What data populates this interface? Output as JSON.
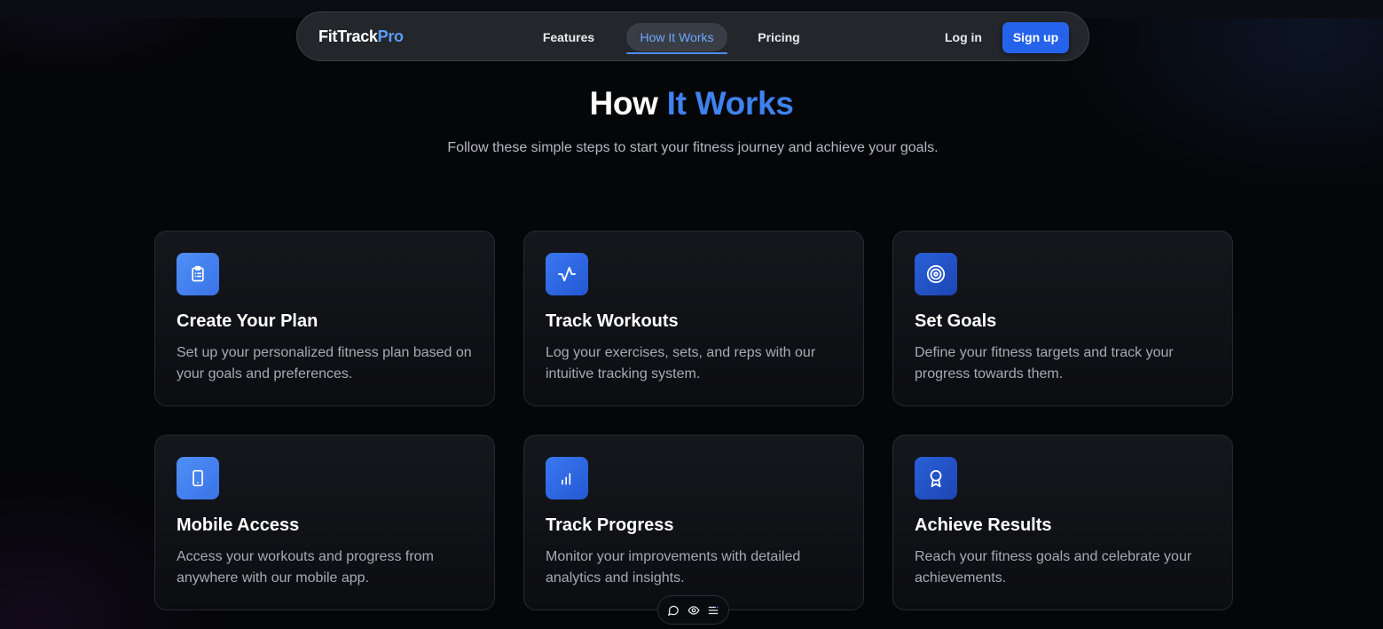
{
  "nav": {
    "logo_part1": "FitTrack",
    "logo_part2": "Pro",
    "links": [
      {
        "label": "Features"
      },
      {
        "label": "How It Works",
        "active": true
      },
      {
        "label": "Pricing"
      }
    ],
    "login_label": "Log in",
    "signup_label": "Sign up"
  },
  "hero": {
    "title_part1": "How",
    "title_part2": "It Works",
    "subtitle": "Follow these simple steps to start your fitness journey and achieve your goals."
  },
  "steps": [
    {
      "icon": "clipboard-list-icon",
      "title": "Create Your Plan",
      "description": "Set up your personalized fitness plan based on your goals and preferences."
    },
    {
      "icon": "activity-pulse-icon",
      "title": "Track Workouts",
      "description": "Log your exercises, sets, and reps with our intuitive tracking system."
    },
    {
      "icon": "target-icon",
      "title": "Set Goals",
      "description": "Define your fitness targets and track your progress towards them."
    },
    {
      "icon": "smartphone-icon",
      "title": "Mobile Access",
      "description": "Access your workouts and progress from anywhere with our mobile app."
    },
    {
      "icon": "bar-chart-icon",
      "title": "Track Progress",
      "description": "Monitor your improvements with detailed analytics and insights."
    },
    {
      "icon": "award-icon",
      "title": "Achieve Results",
      "description": "Reach your fitness goals and celebrate your achievements."
    }
  ],
  "toolbar": {
    "icons": [
      "comment-icon",
      "eye-icon",
      "list-icon"
    ]
  },
  "colors": {
    "accent": "#2563eb",
    "accent_text": "#3f82ee",
    "background": "#050608",
    "card_border": "#262a30"
  }
}
